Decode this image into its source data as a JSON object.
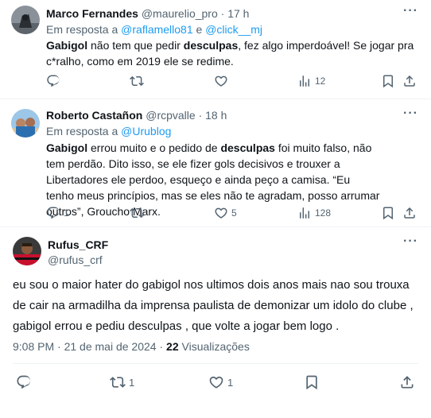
{
  "tweets": [
    {
      "name": "Marco Fernandes",
      "handle": "@maurelio_pro",
      "dot": "·",
      "time": "17 h",
      "reply_prefix": "Em resposta a",
      "reply_to_1": "@raflamello81",
      "reply_and": "e",
      "reply_to_2": "@click__mj",
      "body": [
        {
          "t": "Gabigol",
          "b": true
        },
        {
          "t": " não tem que pedir ",
          "b": false
        },
        {
          "t": "desculpas",
          "b": true
        },
        {
          "t": ", fez algo imperdoável! Se jogar pra c*ralho, como em 2019 ele se redime.",
          "b": false
        }
      ],
      "reply_count": "",
      "retweet_count": "",
      "like_count": "",
      "views_count": "12"
    },
    {
      "name": "Roberto Castañon",
      "handle": "@rcpvalle",
      "dot": "·",
      "time": "18 h",
      "reply_prefix": "Em resposta a",
      "reply_to_1": "@Urublog",
      "body": [
        {
          "t": "Gabigol",
          "b": true
        },
        {
          "t": " errou muito e o pedido de ",
          "b": false
        },
        {
          "t": "desculpas",
          "b": true
        },
        {
          "t": " foi muito falso, não tem perdão. Dito isso, se ele fizer gols decisivos e trouxer a Libertadores ele perdoo, esqueço e ainda peço a camisa. “Eu tenho meus princípios, mas se eles não te agradam, posso arrumar outros”, Groucho Marx.",
          "b": false
        }
      ],
      "reply_count": "1",
      "retweet_count": "",
      "like_count": "5",
      "views_count": "128"
    }
  ],
  "main": {
    "name": "Rufus_CRF",
    "handle": "@rufus_crf",
    "body": "eu sou o maior hater do gabigol nos ultimos dois anos mais nao sou trouxa de cair na armadilha da imprensa paulista de demonizar um idolo do clube , gabigol errou e pediu desculpas , que volte a jogar bem logo .",
    "time": "9:08 PM",
    "dot": "·",
    "date": "21 de mai de 2024",
    "views": "22",
    "views_label": "Visualizações",
    "reply_count": "",
    "retweet_count": "1",
    "like_count": "1"
  },
  "colors": {
    "accent": "#1d9bf0",
    "muted": "#536471",
    "text": "#0f1419"
  },
  "icons": [
    "more-icon",
    "reply-icon",
    "retweet-icon",
    "like-icon",
    "views-icon",
    "bookmark-icon",
    "share-icon"
  ]
}
